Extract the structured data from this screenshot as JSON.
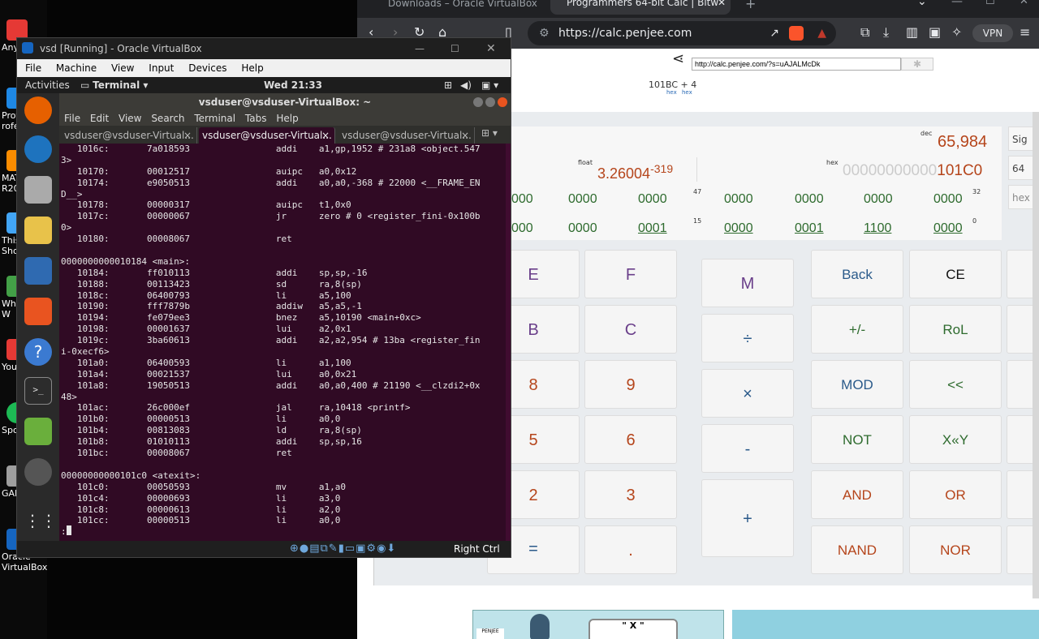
{
  "desktop": {
    "icons": [
      {
        "label": "Any",
        "color": "#e53935"
      },
      {
        "label": "Proto",
        "color": "#1e88e5"
      },
      {
        "label": "rofe",
        "color": "#1e88e5"
      },
      {
        "label": "MAT",
        "color": "#fb8c00"
      },
      {
        "label": "R20",
        "color": "#fb8c00"
      },
      {
        "label": "This",
        "color": "#42a5f5"
      },
      {
        "label": "Sho",
        "color": "#42a5f5"
      },
      {
        "label": "What",
        "color": "#43a047"
      },
      {
        "label": "W",
        "color": "#43a047"
      },
      {
        "label": "You",
        "color": "#e53935"
      },
      {
        "label": "Spo",
        "color": "#1db954"
      },
      {
        "label": "GAI",
        "color": "#9e9e9e"
      },
      {
        "label": "Oracle",
        "color": "#1565c0"
      },
      {
        "label": "VirtualBox",
        "color": "#1565c0"
      }
    ]
  },
  "browser": {
    "tabs": [
      {
        "label": "Downloads – Oracle VirtualBox"
      },
      {
        "label": "Programmers 64-bit Calc | Bitw"
      }
    ],
    "url": "https://calc.penjee.com",
    "vpn_label": "VPN",
    "share_url": "http://calc.penjee.com/?s=uAJALMcDk",
    "expression": "101BC + 4",
    "expression_sub1": "hex",
    "expression_sub2": "hex",
    "dec_label": "dec",
    "dec_value": "65,984",
    "float_label": "float",
    "float_value": "3.26004",
    "float_exp": "-319",
    "hex_label": "hex",
    "hex_value_leading": "00000000000",
    "hex_value": "101C0",
    "side_labels": [
      "Sig",
      "64",
      "hex"
    ],
    "bit_row1": [
      "000",
      "0000",
      "0000",
      "0000",
      "0000",
      "0000",
      "0000"
    ],
    "bit_row2": [
      "000",
      "0000",
      "0001",
      "0000",
      "0001",
      "1100",
      "0000"
    ],
    "bit_idx": [
      "47",
      "32",
      "15",
      "0"
    ],
    "buttons": {
      "e": "E",
      "f": "F",
      "m": "M",
      "back": "Back",
      "ce": "CE",
      "b": "B",
      "c": "C",
      "div": "÷",
      "neg": "+/-",
      "rol": "RoL",
      "n8": "8",
      "n9": "9",
      "mul": "×",
      "mod": "MOD",
      "shl": "<<",
      "n5": "5",
      "n6": "6",
      "sub": "-",
      "not": "NOT",
      "xy": "X«Y",
      "n2": "2",
      "n3": "3",
      "add": "+",
      "and": "AND",
      "or": "OR",
      "eq": "=",
      "dot": ".",
      "nand": "NAND",
      "nor": "NOR"
    },
    "banner_text": "\" X \""
  },
  "vbox": {
    "title": "vsd [Running] - Oracle VirtualBox",
    "menu": [
      "File",
      "Machine",
      "View",
      "Input",
      "Devices",
      "Help"
    ],
    "activities": "Activities",
    "terminal_menu": "Terminal ▾",
    "clock": "Wed 21:33",
    "status_right": "Right Ctrl"
  },
  "terminal": {
    "title": "vsduser@vsduser-VirtualBox: ~",
    "menu": [
      "File",
      "Edit",
      "View",
      "Search",
      "Terminal",
      "Tabs",
      "Help"
    ],
    "tabs": [
      "vsduser@vsduser-Virtual...",
      "vsduser@vsduser-Virtual...",
      "vsduser@vsduser-Virtual..."
    ],
    "lines": [
      "   1016c:       7a018593                addi    a1,gp,1952 # 231a8 <object.547",
      "3>",
      "   10170:       00012517                auipc   a0,0x12",
      "   10174:       e9050513                addi    a0,a0,-368 # 22000 <__FRAME_EN",
      "D__>",
      "   10178:       00000317                auipc   t1,0x0",
      "   1017c:       00000067                jr      zero # 0 <register_fini-0x100b",
      "0>",
      "   10180:       00008067                ret",
      "",
      "0000000000010184 <main>:",
      "   10184:       ff010113                addi    sp,sp,-16",
      "   10188:       00113423                sd      ra,8(sp)",
      "   1018c:       06400793                li      a5,100",
      "   10190:       fff7879b                addiw   a5,a5,-1",
      "   10194:       fe079ee3                bnez    a5,10190 <main+0xc>",
      "   10198:       00001637                lui     a2,0x1",
      "   1019c:       3ba60613                addi    a2,a2,954 # 13ba <register_fin",
      "i-0xecf6>",
      "   101a0:       06400593                li      a1,100",
      "   101a4:       00021537                lui     a0,0x21",
      "   101a8:       19050513                addi    a0,a0,400 # 21190 <__clzdi2+0x",
      "48>",
      "   101ac:       26c000ef                jal     ra,10418 <printf>",
      "   101b0:       00000513                li      a0,0",
      "   101b4:       00813083                ld      ra,8(sp)",
      "   101b8:       01010113                addi    sp,sp,16",
      "   101bc:       00008067                ret",
      "",
      "00000000000101c0 <atexit>:",
      "   101c0:       00050593                mv      a1,a0",
      "   101c4:       00000693                li      a3,0",
      "   101c8:       00000613                li      a2,0",
      "   101cc:       00000513                li      a0,0",
      ":"
    ]
  }
}
